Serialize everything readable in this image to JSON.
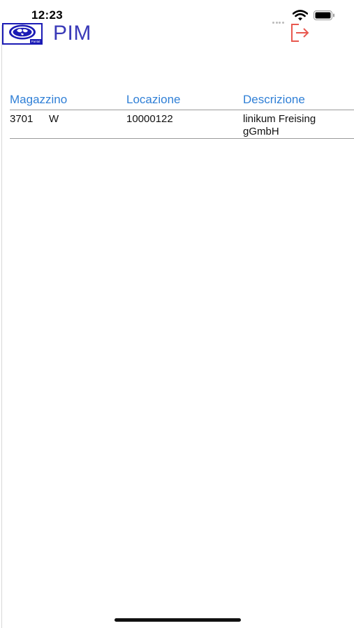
{
  "status_bar": {
    "time": "12:23"
  },
  "header": {
    "title": "PIM",
    "logo_text": "Pantal",
    "logout_icon": "logout-icon"
  },
  "table": {
    "columns": [
      "Magazzino",
      "Locazione",
      "Descrizione"
    ],
    "rows": [
      {
        "magazzino_code": "3701",
        "magazzino_type": "W",
        "locazione": "10000122",
        "descrizione": "linikum Freising gGmbH"
      }
    ]
  },
  "colors": {
    "title": "#3a3ab8",
    "column_header": "#2f7fd6",
    "logout_icon": "#e8584f",
    "logo_blue": "#1b1bb5"
  }
}
